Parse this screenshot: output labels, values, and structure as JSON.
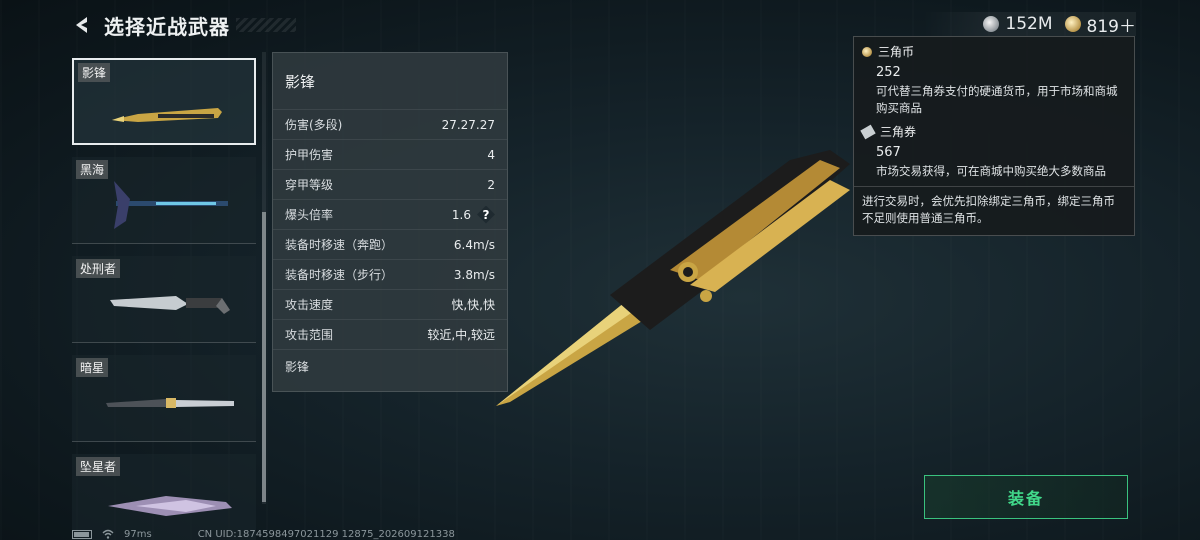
{
  "header": {
    "title": "选择近战武器"
  },
  "currency": {
    "silver": "152M",
    "gold": "819＋"
  },
  "weapons": [
    {
      "name": "影锋"
    },
    {
      "name": "黑海"
    },
    {
      "name": "处刑者"
    },
    {
      "name": "暗星"
    },
    {
      "name": "坠星者"
    }
  ],
  "stats": {
    "title": "影锋",
    "rows": [
      {
        "label": "伤害(多段)",
        "value": "27.27.27"
      },
      {
        "label": "护甲伤害",
        "value": "4"
      },
      {
        "label": "穿甲等级",
        "value": "2"
      },
      {
        "label": "爆头倍率",
        "value": "1.6"
      },
      {
        "label": "装备时移速（奔跑）",
        "value": "6.4m/s"
      },
      {
        "label": "装备时移速（步行）",
        "value": "3.8m/s"
      },
      {
        "label": "攻击速度",
        "value": "快,快,快"
      },
      {
        "label": "攻击范围",
        "value": "较近,中,较远"
      }
    ],
    "footer": "影锋",
    "help": "?"
  },
  "tooltip": {
    "coin_name": "三角币",
    "coin_amount": "252",
    "coin_desc": "可代替三角券支付的硬通货币，用于市场和商城购买商品",
    "voucher_name": "三角券",
    "voucher_amount": "567",
    "voucher_desc": "市场交易获得，可在商城中购买绝大多数商品",
    "note": "进行交易时，会优先扣除绑定三角币，绑定三角币不足则使用普通三角币。"
  },
  "equip_label": "装备",
  "status": {
    "ping": "97ms",
    "uid": "CN UID:1874598497021129 12875_202609121338"
  },
  "colors": {
    "accent_green": "#41d88a",
    "gold": "#c9a544"
  }
}
